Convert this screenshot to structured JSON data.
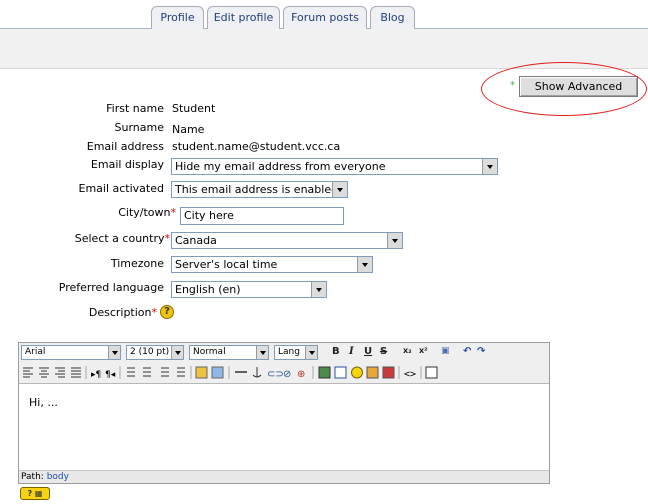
{
  "tabs": [
    {
      "label": "Profile"
    },
    {
      "label": "Edit profile"
    },
    {
      "label": "Forum posts"
    },
    {
      "label": "Blog"
    }
  ],
  "show_advanced_label": "Show Advanced",
  "required_marker": "*",
  "form": {
    "first_name": {
      "label": "First name",
      "value": "Student"
    },
    "surname": {
      "label": "Surname",
      "value": "Name"
    },
    "email": {
      "label": "Email address",
      "value": "student.name@student.vcc.ca"
    },
    "email_display": {
      "label": "Email display",
      "value": "Hide my email address from everyone"
    },
    "email_activated": {
      "label": "Email activated",
      "value": "This email address is enabled"
    },
    "city": {
      "label": "City/town",
      "value": "City here"
    },
    "country": {
      "label": "Select a country",
      "value": "Canada"
    },
    "timezone": {
      "label": "Timezone",
      "value": "Server's local time"
    },
    "language": {
      "label": "Preferred language",
      "value": "English (en)"
    },
    "description": {
      "label": "Description"
    }
  },
  "editor": {
    "font": "Arial",
    "size": "2 (10 pt)",
    "format": "Normal",
    "lang": "Lang",
    "content": "Hi, ...",
    "path_label": "Path:",
    "path_value": "body"
  }
}
